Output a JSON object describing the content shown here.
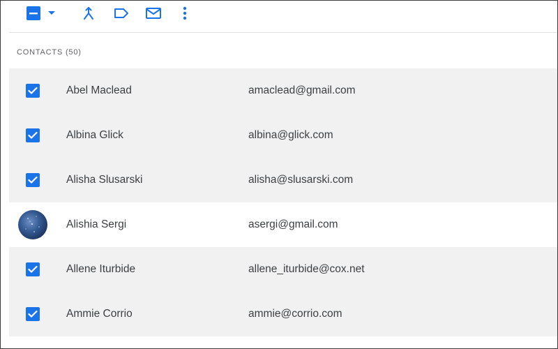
{
  "toolbar": {
    "icons": [
      "select-all-indeterminate-icon",
      "dropdown-caret-icon",
      "merge-icon",
      "label-icon",
      "email-icon",
      "more-vertical-icon"
    ],
    "accent": "#1a73e8"
  },
  "section": {
    "label": "CONTACTS (50)"
  },
  "contacts": [
    {
      "name": "Abel Maclead",
      "email": "amaclead@gmail.com",
      "selected": true
    },
    {
      "name": "Albina Glick",
      "email": "albina@glick.com",
      "selected": true
    },
    {
      "name": "Alisha Slusarski",
      "email": "alisha@slusarski.com",
      "selected": true
    },
    {
      "name": "Alishia Sergi",
      "email": "asergi@gmail.com",
      "selected": false
    },
    {
      "name": "Allene Iturbide",
      "email": "allene_iturbide@cox.net",
      "selected": true
    },
    {
      "name": "Ammie Corrio",
      "email": "ammie@corrio.com",
      "selected": true
    }
  ],
  "colors": {
    "selected_row_bg": "#f1f1f1",
    "checkbox": "#1a73e8",
    "text": "#3c4043",
    "muted_text": "#5f6368"
  }
}
